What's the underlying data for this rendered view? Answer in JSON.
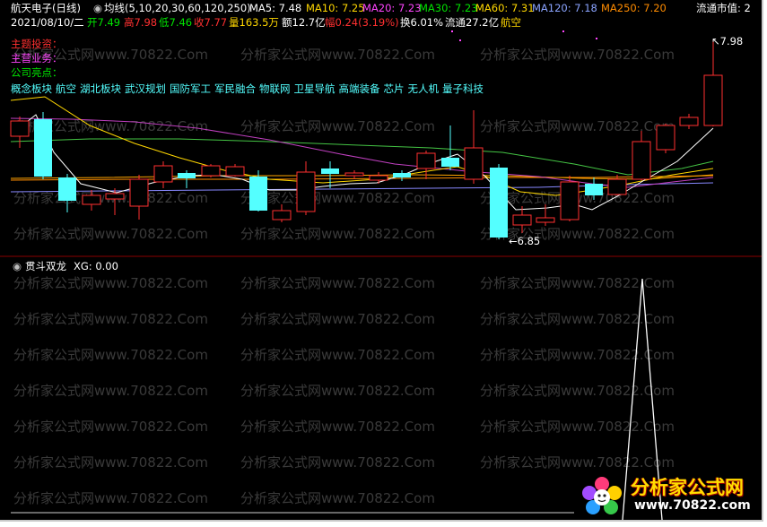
{
  "header": {
    "stock_name": "航天电子(日线)",
    "ma_label": "均线(5,10,20,30,60,120,250)",
    "ma_values": [
      {
        "label": "MA5: 7.48",
        "color": "#ffffff"
      },
      {
        "label": "MA10: 7.25",
        "color": "#ffd700"
      },
      {
        "label": "MA20: 7.23",
        "color": "#ff44ff"
      },
      {
        "label": "MA30: 7.23",
        "color": "#00e400"
      },
      {
        "label": "MA60: 7.31",
        "color": "#ffd700"
      },
      {
        "label": "MA120: 7.18",
        "color": "#8ba4ff"
      },
      {
        "label": "MA250: 7.20",
        "color": "#ff8c00"
      }
    ],
    "market_cap_label": "流通市值: 2",
    "row2": {
      "date": "2021/08/10/二",
      "open": "开7.49",
      "high": "高7.98",
      "low": "低7.46",
      "close": "收7.77",
      "volume": "量163.5万",
      "amount": "额12.7亿",
      "change": "幅0.24(3.19%)",
      "turnover": "换6.01%",
      "float_cap": "流通27.2亿",
      "sector": "航空"
    }
  },
  "info": {
    "main_investment": "主题投资：",
    "main_business": "主营业务：",
    "company_highlight": "公司亮点：",
    "concepts": [
      "概念板块",
      "航空",
      "湖北板块",
      "武汉规划",
      "国防军工",
      "军民融合",
      "物联网",
      "卫星导航",
      "高端装备",
      "芯片",
      "无人机",
      "量子科技"
    ]
  },
  "price_marks": {
    "high": "7.98",
    "low": "6.85"
  },
  "indicator": {
    "name": "贯斗双龙",
    "value_label": "XG: 0.00"
  },
  "watermark": {
    "text_url": "分析家公式网www.70822.Com"
  },
  "logo": {
    "title": "分析家公式网",
    "url": "www.70822.com"
  },
  "colors": {
    "up": "#ff3030",
    "down": "#54ffff",
    "ma5": "#ffffff",
    "ma10": "#ffd700",
    "ma20": "#c040c0",
    "ma30": "#44c444",
    "ma60": "#ffa500",
    "ma120": "#8888ff",
    "ma250": "#ff8c00"
  },
  "chart_data": {
    "type": "candlestick",
    "price_range": [
      6.85,
      7.98
    ],
    "last_candle": {
      "open": 7.49,
      "high": 7.98,
      "low": 7.46,
      "close": 7.77
    },
    "indicator_series": {
      "name": "XG",
      "signal_index": "second-to-last bar",
      "value": 0.0
    }
  }
}
